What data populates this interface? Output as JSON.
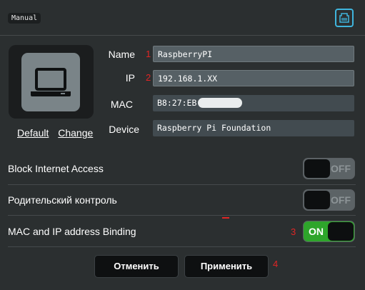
{
  "header": {
    "mode_tag": "Manual",
    "icon": "network-port-icon",
    "accent_color": "#3fb5dd"
  },
  "device": {
    "icon": "laptop-icon",
    "default_link": "Default",
    "change_link": "Change"
  },
  "fields": {
    "name": {
      "label": "Name",
      "marker": "1",
      "value": "RaspberryPI"
    },
    "ip": {
      "label": "IP",
      "marker": "2",
      "value": "192.168.1.XX"
    },
    "mac": {
      "label": "MAC",
      "value": "B8:27:EB"
    },
    "vendor": {
      "label": "Device",
      "value": "Raspberry Pi Foundation"
    }
  },
  "settings": {
    "block_internet": {
      "label": "Block Internet Access",
      "state": "OFF"
    },
    "parental": {
      "label": "Родительский контроль",
      "state": "OFF"
    },
    "binding": {
      "label": "MAC and IP address Binding",
      "state": "ON",
      "marker": "3"
    }
  },
  "buttons": {
    "cancel": "Отменить",
    "apply": "Применить",
    "marker": "4"
  },
  "colors": {
    "background": "#2b2f30",
    "toggle_on": "#2ea52b",
    "marker_red": "#e02525"
  }
}
